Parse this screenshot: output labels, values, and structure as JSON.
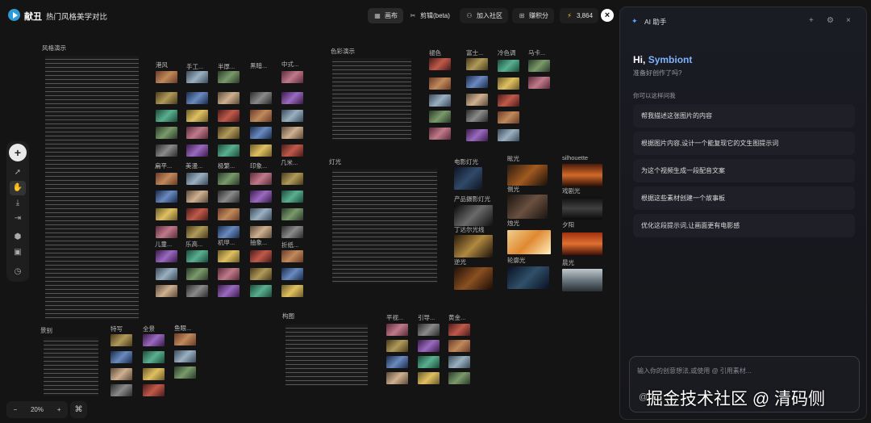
{
  "app": {
    "brand": "献丑",
    "doc_title": "热门风格美学对比"
  },
  "topbar": {
    "canvas_label": "画布",
    "edit_label": "剪辑(beta)",
    "community_label": "加入社区",
    "earn_label": "赚积分",
    "credits": "3,864"
  },
  "sections": {
    "style_demo": "风格演示",
    "color_demo": "色彩演示",
    "lighting": "灯光",
    "scene": "景别",
    "composition": "构图"
  },
  "columns": {
    "s1": "港风",
    "s2": "手工...",
    "s3": "半厚...",
    "s4": "黑暗...",
    "s5": "中式...",
    "s6": "扁平...",
    "s7": "美漫...",
    "s8": "极繁...",
    "s9": "印象...",
    "s10": "几米...",
    "s11": "儿童...",
    "s12": "乐高...",
    "s13": "机甲...",
    "s14": "抽象...",
    "s15": "折纸...",
    "c1": "褪色",
    "c2": "富士...",
    "c3": "冷色调",
    "c4": "马卡...",
    "l1": "电影灯光",
    "l2": "眩光",
    "l3": "silhouette",
    "l4": "产品摄影灯光",
    "l5": "丁达尔光线",
    "l6": "逆光",
    "l7": "戏剧光",
    "l8": "夕阳",
    "l9": "烛光",
    "l10": "轮廓光",
    "l11": "晨光",
    "l12": "侧光",
    "sc1": "特写",
    "sc2": "全景",
    "sc3": "鱼眼...",
    "cp1": "平视...",
    "cp2": "引导...",
    "cp3": "黄金..."
  },
  "zoom": {
    "minus": "−",
    "value": "20%",
    "plus": "+",
    "cmd": "⌘"
  },
  "ai_panel": {
    "title": "AI 助手",
    "greeting": "Hi,",
    "username": "Symbiont",
    "subtitle": "准备好创作了吗?",
    "ask_hint": "你可以这样问我",
    "suggestions": [
      "帮我描述这张图片的内容",
      "根据图片内容,设计一个能复现它的文生图提示词",
      "为这个视频生成一段配音文案",
      "根据这些素材创建一个故事板",
      "优化这段提示词,让画面更有电影感"
    ],
    "input_placeholder": "输入你的创意想法,或使用 @ 引用素材...",
    "at_symbol": "@"
  },
  "watermark": "掘金技术社区 @ 清码侧",
  "icons": {
    "logo": "play-logo-icon",
    "canvas": "grid-icon",
    "edit": "scissors-icon",
    "community": "users-icon",
    "earn": "gift-icon",
    "credits": "lightning-icon",
    "close": "close-icon",
    "ai": "sparkle-icon",
    "new_chat": "plus-icon",
    "settings": "gear-icon",
    "panel_close": "close-icon"
  },
  "colors": {
    "accent": "#2e9bd6",
    "name_highlight": "#7fb3ff",
    "credits_bolt": "#f5c542"
  }
}
